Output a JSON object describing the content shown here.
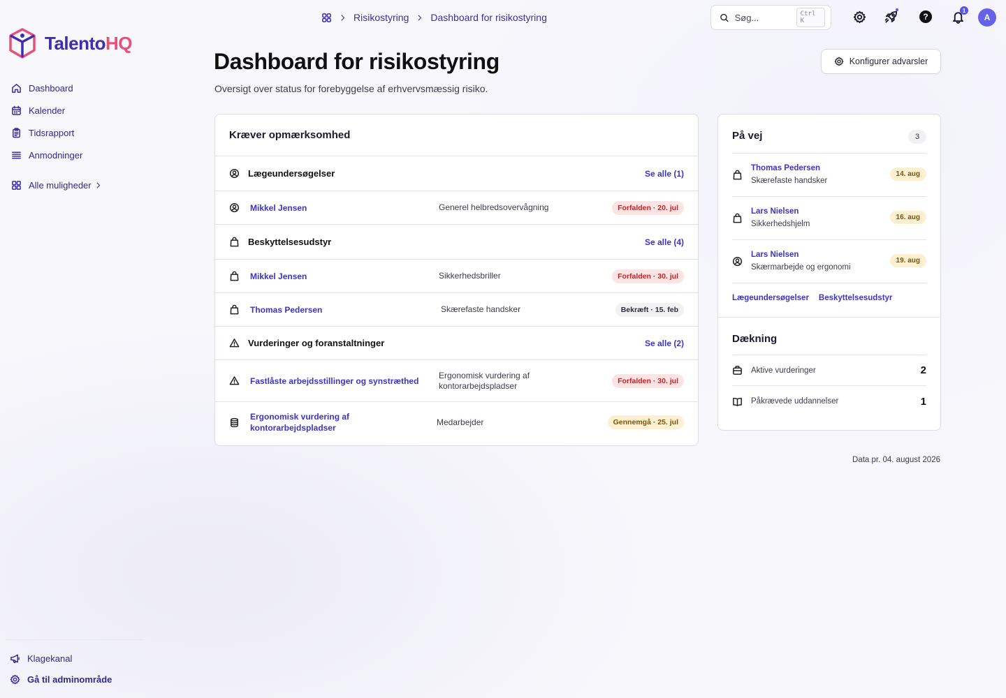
{
  "brand": {
    "name_part1": "Talento",
    "name_part2": "HQ",
    "color_primary": "#3b2fb0",
    "color_accent": "#e8507a"
  },
  "sidebar": {
    "items": [
      {
        "label": "Dashboard",
        "icon": "home-icon"
      },
      {
        "label": "Kalender",
        "icon": "calendar-icon"
      },
      {
        "label": "Tidsrapport",
        "icon": "clipboard-icon"
      },
      {
        "label": "Anmodninger",
        "icon": "list-icon"
      }
    ],
    "all_options": "Alle muligheder",
    "bottom": [
      {
        "label": "Klagekanal",
        "icon": "megaphone-icon"
      },
      {
        "label": "Gå til adminområde",
        "icon": "gear-icon"
      }
    ]
  },
  "breadcrumb": {
    "items": [
      "Risikostyring",
      "Dashboard for risikostyring"
    ]
  },
  "search": {
    "placeholder": "Søg...",
    "shortcut": "Ctrl K"
  },
  "topbar": {
    "notification_count": "1",
    "avatar_initial": "A"
  },
  "header": {
    "title": "Dashboard for risikostyring",
    "subtitle": "Oversigt over status for forebyggelse af erhvervsmæssig risiko.",
    "config_button": "Konfigurer advarsler"
  },
  "attention": {
    "title": "Kræver opmærksomhed",
    "sections": [
      {
        "title": "Lægeundersøgelser",
        "see_all": "Se alle (1)",
        "icon": "user-circle-icon",
        "items": [
          {
            "name": "Mikkel Jensen",
            "desc": "Generel helbredsovervågning",
            "badge": "Forfalden · 20. jul",
            "status": "overdue",
            "icon": "user-circle-icon"
          }
        ]
      },
      {
        "title": "Beskyttelsesudstyr",
        "see_all": "Se alle (4)",
        "icon": "bag-icon",
        "items": [
          {
            "name": "Mikkel Jensen",
            "desc": "Sikkerhedsbriller",
            "badge": "Forfalden · 30. jul",
            "status": "overdue",
            "icon": "bag-icon"
          },
          {
            "name": "Thomas Pedersen",
            "desc": "Skærefaste handsker",
            "badge": "Bekræft · 15. feb",
            "status": "confirm",
            "icon": "bag-icon"
          }
        ]
      },
      {
        "title": "Vurderinger og foranstaltninger",
        "see_all": "Se alle (2)",
        "icon": "warning-icon",
        "items": [
          {
            "name": "Fastlåste arbejdsstillinger og synstræthed",
            "desc": "Ergonomisk vurdering af kontorarbejdspladser",
            "badge": "Forfalden · 30. jul",
            "status": "overdue",
            "icon": "warning-icon"
          },
          {
            "name": "Ergonomisk vurdering af kontorarbejdspladser",
            "desc": "Medarbejder",
            "badge": "Gennemgå · 25. jul",
            "status": "review",
            "icon": "database-icon"
          }
        ]
      }
    ]
  },
  "on_the_way": {
    "title": "På vej",
    "count": "3",
    "items": [
      {
        "name": "Thomas Pedersen",
        "sub": "Skærefaste handsker",
        "date": "14. aug",
        "icon": "bag-icon"
      },
      {
        "name": "Lars Nielsen",
        "sub": "Sikkerhedshjelm",
        "date": "16. aug",
        "icon": "bag-icon"
      },
      {
        "name": "Lars Nielsen",
        "sub": "Skærmarbejde og ergonomi",
        "date": "19. aug",
        "icon": "user-circle-icon"
      }
    ],
    "links": [
      "Lægeundersøgelser",
      "Beskyttelsesudstyr"
    ]
  },
  "coverage": {
    "title": "Dækning",
    "items": [
      {
        "label": "Aktive vurderinger",
        "value": "2",
        "icon": "briefcase-icon"
      },
      {
        "label": "Påkrævede uddannelser",
        "value": "1",
        "icon": "book-icon"
      }
    ]
  },
  "data_note": "Data pr. 04. august 2026"
}
